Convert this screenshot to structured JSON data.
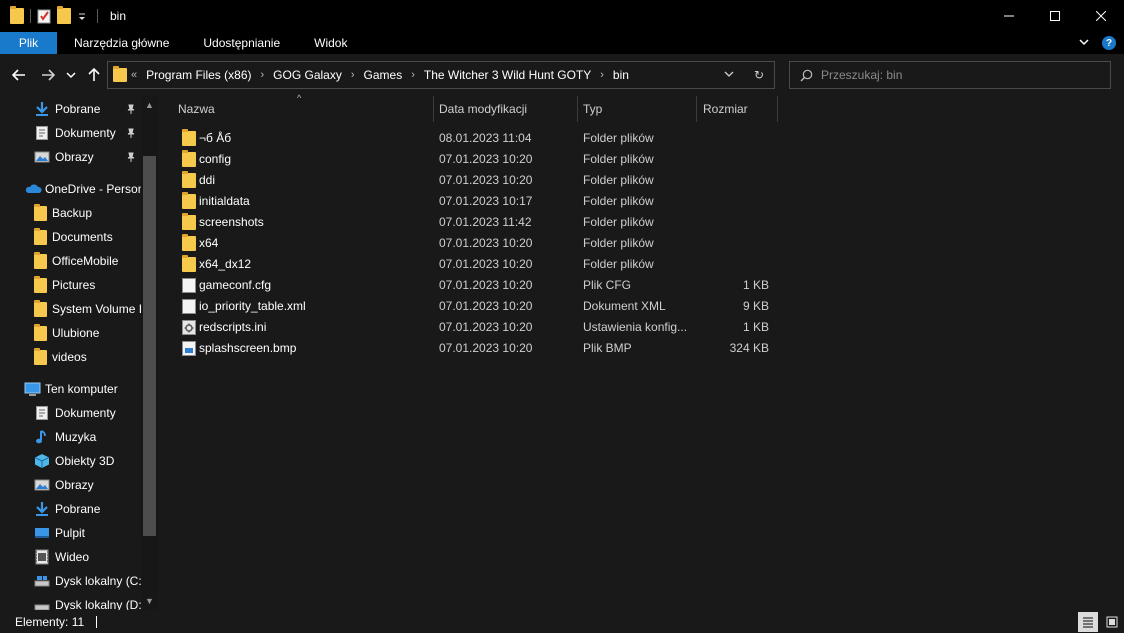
{
  "window": {
    "title": "bin",
    "minimize_label": "—",
    "maximize_label": "☐",
    "close_label": "✕"
  },
  "ribbon": {
    "tabs": [
      "Plik",
      "Narzędzia główne",
      "Udostępnianie",
      "Widok"
    ],
    "expand_glyph": "⌄",
    "help_glyph": "?"
  },
  "nav": {
    "back_glyph": "←",
    "forward_glyph": "→",
    "recent_glyph": "⌄",
    "up_glyph": "↑"
  },
  "address": {
    "overflow_glyph": "«",
    "separator_glyph": "›",
    "crumbs": [
      "Program Files (x86)",
      "GOG Galaxy",
      "Games",
      "The Witcher 3 Wild Hunt GOTY",
      "bin"
    ],
    "dropdown_glyph": "⌄",
    "refresh_glyph": "↻"
  },
  "search": {
    "placeholder": "Przeszukaj: bin",
    "value": ""
  },
  "sidebar": {
    "items": [
      {
        "label": "Pobrane",
        "icon": "download-icon",
        "pinned": true
      },
      {
        "label": "Dokumenty",
        "icon": "documents-icon",
        "pinned": true
      },
      {
        "label": "Obrazy",
        "icon": "pictures-icon",
        "pinned": true
      },
      {
        "label": "OneDrive - Personal",
        "icon": "onedrive-icon",
        "pinned": false
      },
      {
        "label": "Backup",
        "icon": "folder-icon",
        "pinned": false
      },
      {
        "label": "Documents",
        "icon": "folder-icon",
        "pinned": false
      },
      {
        "label": "OfficeMobile",
        "icon": "folder-icon",
        "pinned": false
      },
      {
        "label": "Pictures",
        "icon": "folder-icon",
        "pinned": false
      },
      {
        "label": "System Volume Information",
        "icon": "folder-icon",
        "pinned": false
      },
      {
        "label": "Ulubione",
        "icon": "folder-icon",
        "pinned": false
      },
      {
        "label": "videos",
        "icon": "folder-icon",
        "pinned": false
      },
      {
        "label": "Ten komputer",
        "icon": "computer-icon",
        "pinned": false
      },
      {
        "label": "Dokumenty",
        "icon": "documents-icon",
        "pinned": false
      },
      {
        "label": "Muzyka",
        "icon": "music-icon",
        "pinned": false
      },
      {
        "label": "Obiekty 3D",
        "icon": "objects-3d-icon",
        "pinned": false
      },
      {
        "label": "Obrazy",
        "icon": "pictures-icon",
        "pinned": false
      },
      {
        "label": "Pobrane",
        "icon": "download-icon",
        "pinned": false
      },
      {
        "label": "Pulpit",
        "icon": "desktop-icon",
        "pinned": false
      },
      {
        "label": "Wideo",
        "icon": "video-icon",
        "pinned": false
      },
      {
        "label": "Dysk lokalny (C:)",
        "icon": "drive-icon",
        "pinned": false
      },
      {
        "label": "Dysk lokalny (D:)",
        "icon": "drive-icon",
        "pinned": false
      }
    ],
    "pin_glyph": "📌"
  },
  "columns": {
    "name": "Nazwa",
    "date": "Data modyfikacji",
    "type": "Typ",
    "size": "Rozmiar",
    "sort_glyph": "^"
  },
  "files": [
    {
      "name": "¬б Åб",
      "date": "08.01.2023 11:04",
      "type": "Folder plików",
      "size": "",
      "icon": "folder-icon"
    },
    {
      "name": "config",
      "date": "07.01.2023 10:20",
      "type": "Folder plików",
      "size": "",
      "icon": "folder-icon"
    },
    {
      "name": "ddi",
      "date": "07.01.2023 10:20",
      "type": "Folder plików",
      "size": "",
      "icon": "folder-icon"
    },
    {
      "name": "initialdata",
      "date": "07.01.2023 10:17",
      "type": "Folder plików",
      "size": "",
      "icon": "folder-icon"
    },
    {
      "name": "screenshots",
      "date": "07.01.2023 11:42",
      "type": "Folder plików",
      "size": "",
      "icon": "folder-icon"
    },
    {
      "name": "x64",
      "date": "07.01.2023 10:20",
      "type": "Folder plików",
      "size": "",
      "icon": "folder-icon"
    },
    {
      "name": "x64_dx12",
      "date": "07.01.2023 10:20",
      "type": "Folder plików",
      "size": "",
      "icon": "folder-icon"
    },
    {
      "name": "gameconf.cfg",
      "date": "07.01.2023 10:20",
      "type": "Plik CFG",
      "size": "1 KB",
      "icon": "file-icon"
    },
    {
      "name": "io_priority_table.xml",
      "date": "07.01.2023 10:20",
      "type": "Dokument XML",
      "size": "9 KB",
      "icon": "file-icon"
    },
    {
      "name": "redscripts.ini",
      "date": "07.01.2023 10:20",
      "type": "Ustawienia konfig...",
      "size": "1 KB",
      "icon": "settings-file-icon"
    },
    {
      "name": "splashscreen.bmp",
      "date": "07.01.2023 10:20",
      "type": "Plik BMP",
      "size": "324 KB",
      "icon": "image-file-icon"
    }
  ],
  "status": {
    "items_count": "Elementy: 11"
  },
  "colors": {
    "accent": "#1979ca",
    "folder": "#f6c84c",
    "background": "#191919",
    "titlebar": "#000000"
  }
}
